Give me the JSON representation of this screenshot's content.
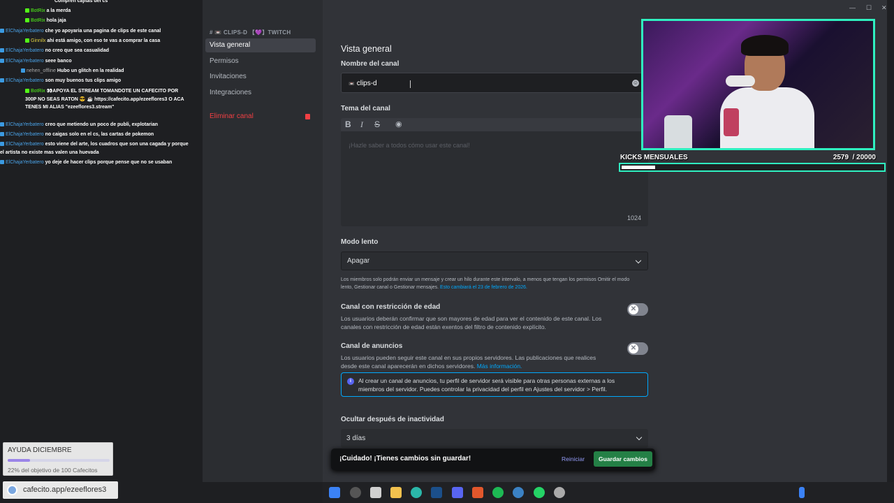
{
  "chat": {
    "messages": [
      {
        "user": "",
        "text": "Compren cajitas del cs"
      },
      {
        "user": "BotRix",
        "text": "a la merda"
      },
      {
        "user": "BotRix",
        "text": "hola jaja"
      },
      {
        "user": "ElChajaYerbatero",
        "text": "che yo apoyaria una pagina de clips de este canal"
      },
      {
        "user": "Ginnilx",
        "text": "ahi está amigo, con eso te vas a comprar la casa"
      },
      {
        "user": "ElChajaYerbatero",
        "text": "no creo que sea casualidad"
      },
      {
        "user": "ElChajaYerbatero",
        "text": "seee banco"
      },
      {
        "user": "nehen_offline",
        "text": "Hubo un glitch en la realidad"
      },
      {
        "user": "ElChajaYerbatero",
        "text": "son muy buenos tus clips amigo"
      },
      {
        "user": "BotRix",
        "text": "👀APOYA EL STREAM TOMANDOTE UN CAFECITO POR 300P NO SEAS RATON 😎 ☕ https://cafecito.app/ezeeflores3 O ACA TENES MI ALIAS \"ezeeflores3.stream\""
      },
      {
        "user": "ElChajaYerbatero",
        "text": "creo que metiendo un poco de publi, explotarian"
      },
      {
        "user": "ElChajaYerbatero",
        "text": "no caigas solo en el cs, las cartas de pokemon"
      },
      {
        "user": "ElChajaYerbatero",
        "text": "esto viene del arte, los cuadros que son una cagada y porque el artista no existe mas valen una huevada"
      },
      {
        "user": "ElChajaYerbatero",
        "text": "yo deje de hacer clips porque pense que no se usaban"
      }
    ]
  },
  "sidebar": {
    "header": "# 📼 CLIPS-D 【💜】TWITCH",
    "items": [
      {
        "label": "Vista general"
      },
      {
        "label": "Permisos"
      },
      {
        "label": "Invitaciones"
      },
      {
        "label": "Integraciones"
      }
    ],
    "delete_label": "Eliminar canal"
  },
  "main": {
    "title": "Vista general",
    "name_label": "Nombre del canal",
    "name_value": "clips-d",
    "name_hash": "📼",
    "topic_label": "Tema del canal",
    "topic_placeholder": "¡Hazle saber a todos cómo usar este canal!",
    "topic_counter": "1024",
    "slow_label": "Modo lento",
    "slow_value": "Apagar",
    "slow_help": "Los miembros solo podrán enviar un mensaje y crear un hilo durante este intervalo, a menos que tengan los permisos Omitir el modo lento, Gestionar canal o Gestionar mensajes.",
    "slow_help_link": "Esto cambiará el 23 de febrero de 2026.",
    "age_label": "Canal con restricción de edad",
    "age_desc": "Los usuarios deberán confirmar que son mayores de edad para ver el contenido de este canal. Los canales con restricción de edad están exentos del filtro de contenido explícito.",
    "news_label": "Canal de anuncios",
    "news_desc": "Los usuarios pueden seguir este canal en sus propios servidores. Las publicaciones que realices desde este canal aparecerán en dichos servidores.",
    "news_link": "Más información.",
    "notice": "Al crear un canal de anuncios, tu perfil de servidor será visible para otras personas externas a los miembros del servidor. Puedes controlar la privacidad del perfil en Ajustes del servidor > Perfil.",
    "inactive_label": "Ocultar después de inactividad",
    "inactive_value": "3 días"
  },
  "unsaved": {
    "text": "¡Cuidado! ¡Tienes cambios sin guardar!",
    "reset": "Reiniciar",
    "save": "Guardar cambios"
  },
  "kicks": {
    "label": "KICKS MENSUALES",
    "current": "2579",
    "goal": "/ 20000",
    "progress": 0.129
  },
  "ayuda": {
    "title": "AYUDA DICIEMBRE",
    "subtitle": "22% del objetivo de 100 Cafecitos",
    "progress": 0.22
  },
  "cafecito": {
    "url": "cafecito.app/ezeeflores3"
  },
  "colors": {
    "accent": "#2ff0c0",
    "save": "#248046",
    "danger": "#f23f43",
    "link": "#00a8fc"
  },
  "icons": {
    "bold": "bold-icon",
    "italic": "italic-icon",
    "strike": "strikethrough-icon",
    "preview": "eye-icon"
  }
}
